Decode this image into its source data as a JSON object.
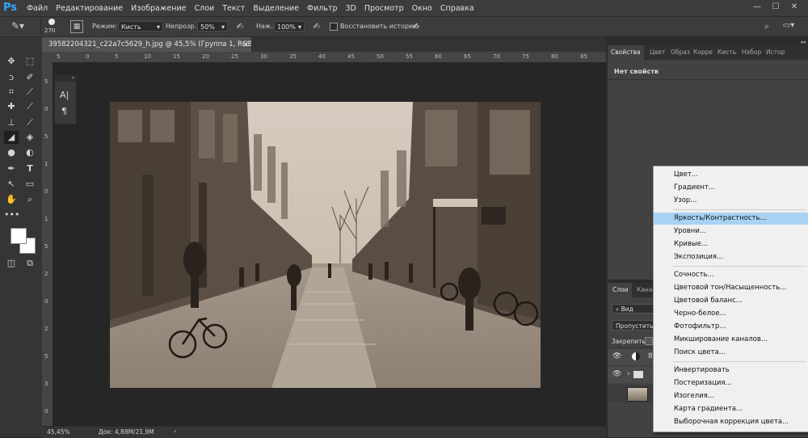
{
  "app": {
    "logo": "Ps"
  },
  "menu": [
    "Файл",
    "Редактирование",
    "Изображение",
    "Слои",
    "Текст",
    "Выделение",
    "Фильтр",
    "3D",
    "Просмотр",
    "Окно",
    "Справка"
  ],
  "window_controls": {
    "minimize": "—",
    "maximize": "☐",
    "close": "✕"
  },
  "options": {
    "brush_size": "270",
    "mode_label": "Режим:",
    "mode_value": "Кисть",
    "opacity_label": "Непрозр.:",
    "opacity_value": "50%",
    "pressure_label": "Наж.:",
    "pressure_value": "100%",
    "restore_history": "Восстановить историю"
  },
  "document_tab": {
    "title": "39582204321_c22a7c5629_h.jpg @ 45,5% (Группа 1, RGB/8*) *",
    "close": "×"
  },
  "ruler_top": [
    "5",
    "0",
    "5",
    "10",
    "15",
    "20",
    "25",
    "30",
    "35",
    "40",
    "45",
    "50",
    "55",
    "60",
    "65",
    "70",
    "75",
    "80",
    "85"
  ],
  "ruler_left": [
    "5",
    "0",
    "5",
    "1",
    "0",
    "1",
    "5",
    "2",
    "0",
    "2",
    "5",
    "3",
    "0"
  ],
  "status": {
    "zoom": "45,45%",
    "doc": "Док: 4,88M/21,9M"
  },
  "panels": {
    "tabs": [
      "Свойства",
      "Цвет",
      "Образ",
      "Корре",
      "Кисть",
      "Набор",
      "Истор"
    ],
    "properties_empty": "Нет свойств"
  },
  "layers": {
    "tabs": [
      "Слои",
      "Кана"
    ],
    "search_label": "Вид",
    "blend_mode": "Пропустить",
    "lock_label": "Закрепить:"
  },
  "context_menu": [
    {
      "label": "Цвет...",
      "selected": false
    },
    {
      "label": "Градиент...",
      "selected": false
    },
    {
      "label": "Узор...",
      "selected": false
    },
    {
      "sep": true
    },
    {
      "label": "Яркость/Контрастность...",
      "selected": true
    },
    {
      "label": "Уровни...",
      "selected": false
    },
    {
      "label": "Кривые...",
      "selected": false
    },
    {
      "label": "Экспозиция...",
      "selected": false
    },
    {
      "sep": true
    },
    {
      "label": "Сочность...",
      "selected": false
    },
    {
      "label": "Цветовой тон/Насыщенность...",
      "selected": false
    },
    {
      "label": "Цветовой баланс...",
      "selected": false
    },
    {
      "label": "Черно-белое...",
      "selected": false
    },
    {
      "label": "Фотофильтр...",
      "selected": false
    },
    {
      "label": "Микширование каналов...",
      "selected": false
    },
    {
      "label": "Поиск цвета...",
      "selected": false
    },
    {
      "sep": true
    },
    {
      "label": "Инвертировать",
      "selected": false
    },
    {
      "label": "Постеризация...",
      "selected": false
    },
    {
      "label": "Изогелия...",
      "selected": false
    },
    {
      "label": "Карта градиента...",
      "selected": false
    },
    {
      "label": "Выборочная коррекция цвета...",
      "selected": false
    }
  ],
  "colors": {
    "accent": "#31a8ff",
    "menu_highlight": "#a8d3f4",
    "sepia_light": "#cfc3b3",
    "sepia_dark": "#4a3f34"
  }
}
